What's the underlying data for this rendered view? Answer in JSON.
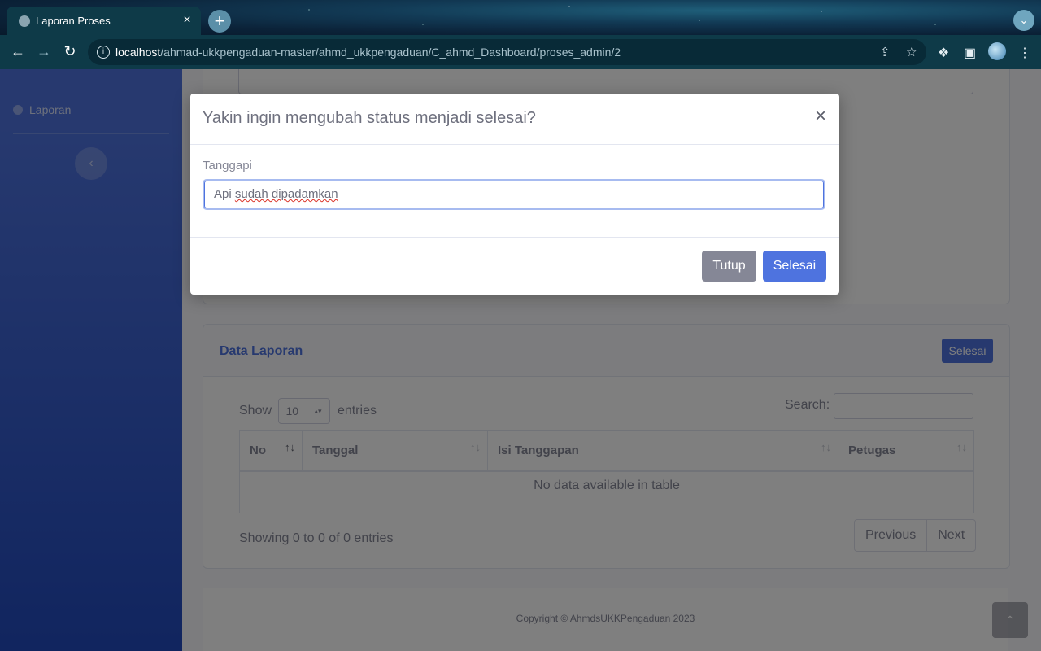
{
  "browser": {
    "tab_title": "Laporan Proses",
    "tab_close": "×",
    "new_tab": "+",
    "url_host": "localhost",
    "url_path": "/ahmad-ukkpengaduan-master/ahmd_ukkpengaduan/C_ahmd_Dashboard/proses_admin/2"
  },
  "sidebar": {
    "items": [
      {
        "label": "Laporan",
        "icon": "info-circle-icon"
      }
    ],
    "toggle_icon": "chevron-left-icon"
  },
  "data_card": {
    "title": "Data Laporan",
    "button_label": "Selesai",
    "show_label": "Show",
    "entries_value": "10",
    "entries_label": "entries",
    "search_label": "Search:",
    "columns": [
      "No",
      "Tanggal",
      "Isi Tanggapan",
      "Petugas"
    ],
    "empty_message": "No data available in table",
    "info": "Showing 0 to 0 of 0 entries",
    "pagination": {
      "previous": "Previous",
      "next": "Next"
    }
  },
  "footer": {
    "copyright": "Copyright © AhmdsUKKPengaduan 2023"
  },
  "modal": {
    "title": "Yakin ingin mengubah status menjadi selesai?",
    "close_symbol": "×",
    "field_label": "Tanggapi",
    "input_value_plain": "Api ",
    "input_value_spell": "sudah dipadamkan",
    "buttons": {
      "close": "Tutup",
      "confirm": "Selesai"
    }
  },
  "colors": {
    "primary": "#4e73df",
    "secondary": "#858796",
    "sidebar_start": "#4e73df",
    "sidebar_end": "#224abe"
  }
}
